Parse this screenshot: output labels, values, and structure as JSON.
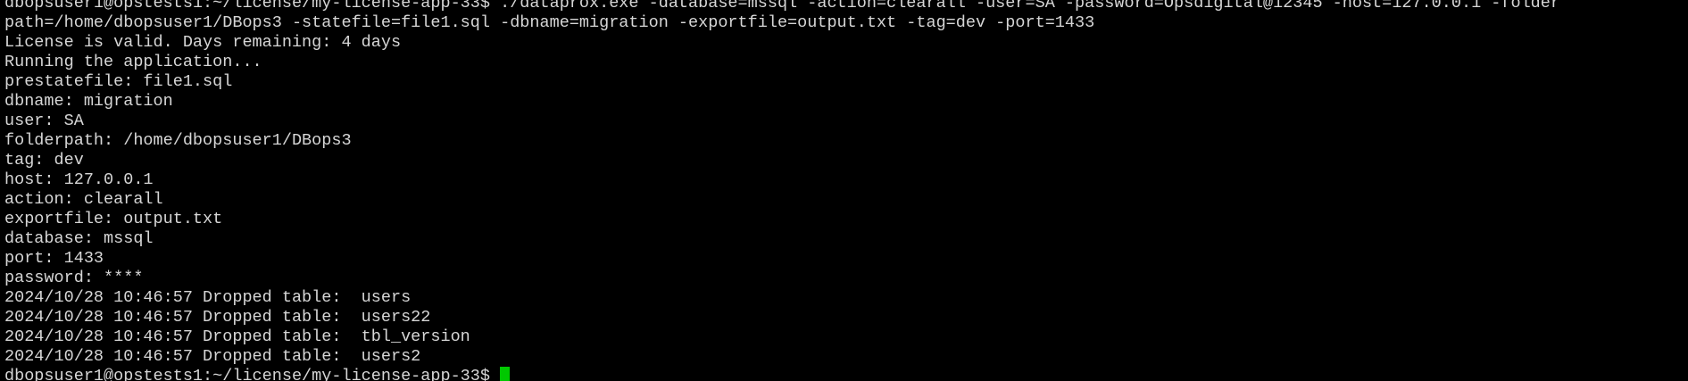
{
  "terminal": {
    "cursor_color": "#00c800",
    "lines": [
      {
        "kind": "output",
        "text": "dbopsuser1@opstests1:~/license/my-license-app-33$ ./dataprox.exe -database=mssql -action=clearall -user=SA -password=Opsdigital@12345 -host=127.0.0.1 -folder"
      },
      {
        "kind": "output",
        "text": "path=/home/dbopsuser1/DBops3 -statefile=file1.sql -dbname=migration -exportfile=output.txt -tag=dev -port=1433"
      },
      {
        "kind": "output",
        "text": "License is valid. Days remaining: 4 days"
      },
      {
        "kind": "output",
        "text": "Running the application..."
      },
      {
        "kind": "output",
        "text": "prestatefile: file1.sql"
      },
      {
        "kind": "output",
        "text": "dbname: migration"
      },
      {
        "kind": "output",
        "text": "user: SA"
      },
      {
        "kind": "output",
        "text": "folderpath: /home/dbopsuser1/DBops3"
      },
      {
        "kind": "output",
        "text": "tag: dev"
      },
      {
        "kind": "output",
        "text": "host: 127.0.0.1"
      },
      {
        "kind": "output",
        "text": "action: clearall"
      },
      {
        "kind": "output",
        "text": "exportfile: output.txt"
      },
      {
        "kind": "output",
        "text": "database: mssql"
      },
      {
        "kind": "output",
        "text": "port: 1433"
      },
      {
        "kind": "output",
        "text": "password: ****"
      },
      {
        "kind": "output",
        "text": "2024/10/28 10:46:57 Dropped table:  users"
      },
      {
        "kind": "output",
        "text": "2024/10/28 10:46:57 Dropped table:  users22"
      },
      {
        "kind": "output",
        "text": "2024/10/28 10:46:57 Dropped table:  tbl_version"
      },
      {
        "kind": "output",
        "text": "2024/10/28 10:46:57 Dropped table:  users2"
      },
      {
        "kind": "prompt",
        "text": "dbopsuser1@opstests1:~/license/my-license-app-33$ "
      }
    ]
  }
}
